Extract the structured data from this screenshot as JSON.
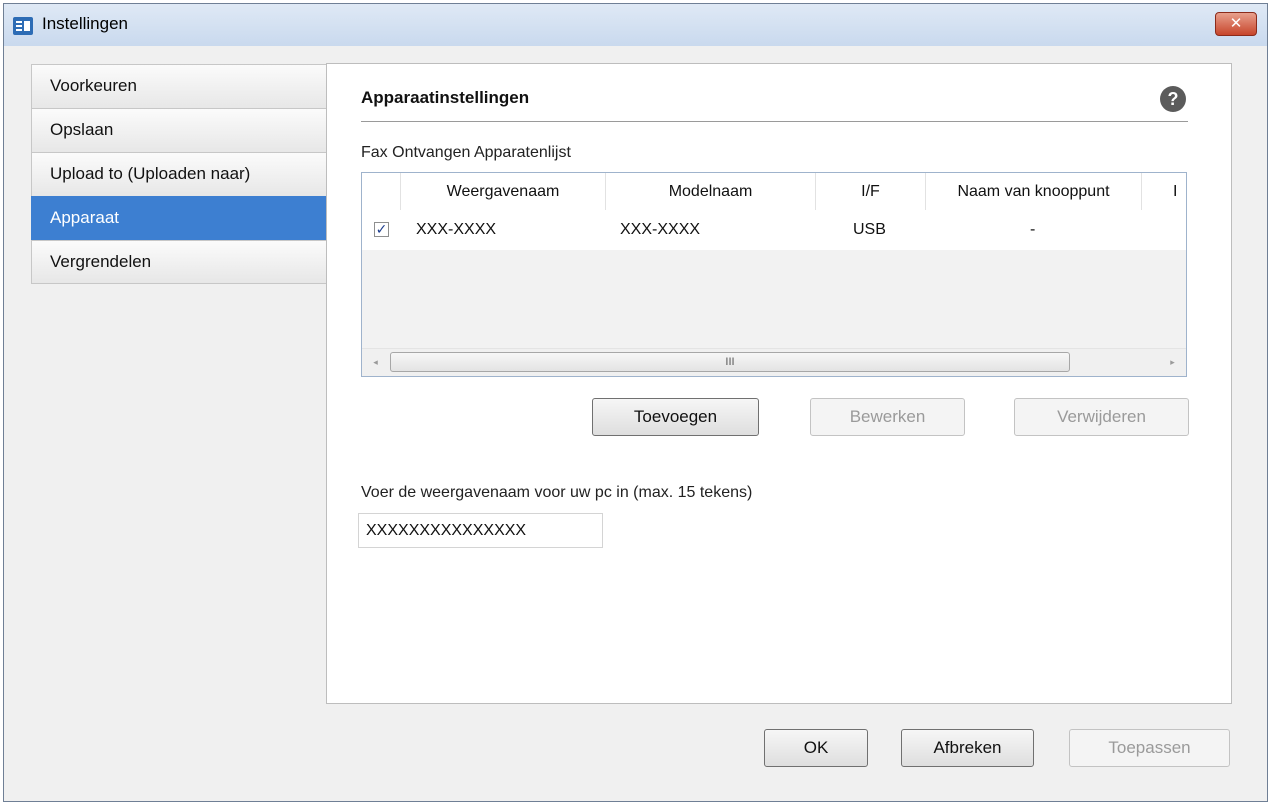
{
  "window": {
    "title": "Instellingen",
    "close_glyph": "✕"
  },
  "sidebar": {
    "items": [
      {
        "label": "Voorkeuren",
        "selected": false
      },
      {
        "label": "Opslaan",
        "selected": false
      },
      {
        "label": "Upload to (Uploaden naar)",
        "selected": false
      },
      {
        "label": "Apparaat",
        "selected": true
      },
      {
        "label": "Vergrendelen",
        "selected": false
      }
    ]
  },
  "panel": {
    "title": "Apparaatinstellingen",
    "help_glyph": "?",
    "list_label": "Fax Ontvangen Apparatenlijst",
    "table": {
      "columns": [
        "Weergavenaam",
        "Modelnaam",
        "I/F",
        "Naam van knooppunt",
        "I"
      ],
      "rows": [
        {
          "checked": true,
          "cells": [
            "XXX-XXXX",
            "XXX-XXXX",
            "USB",
            "-"
          ]
        }
      ],
      "scroll": {
        "left_arrow": "◂",
        "right_arrow": "▸",
        "thumb_grip": "III"
      }
    },
    "buttons": {
      "add": "Toevoegen",
      "edit": "Bewerken",
      "delete": "Verwijderen"
    },
    "name_field": {
      "label": "Voer de weergavenaam voor uw pc in (max. 15 tekens)",
      "value": "XXXXXXXXXXXXXXX"
    }
  },
  "footer": {
    "ok": "OK",
    "cancel": "Afbreken",
    "apply": "Toepassen"
  },
  "colors": {
    "selection": "#3d7fd1",
    "close_button": "#c7452b"
  }
}
